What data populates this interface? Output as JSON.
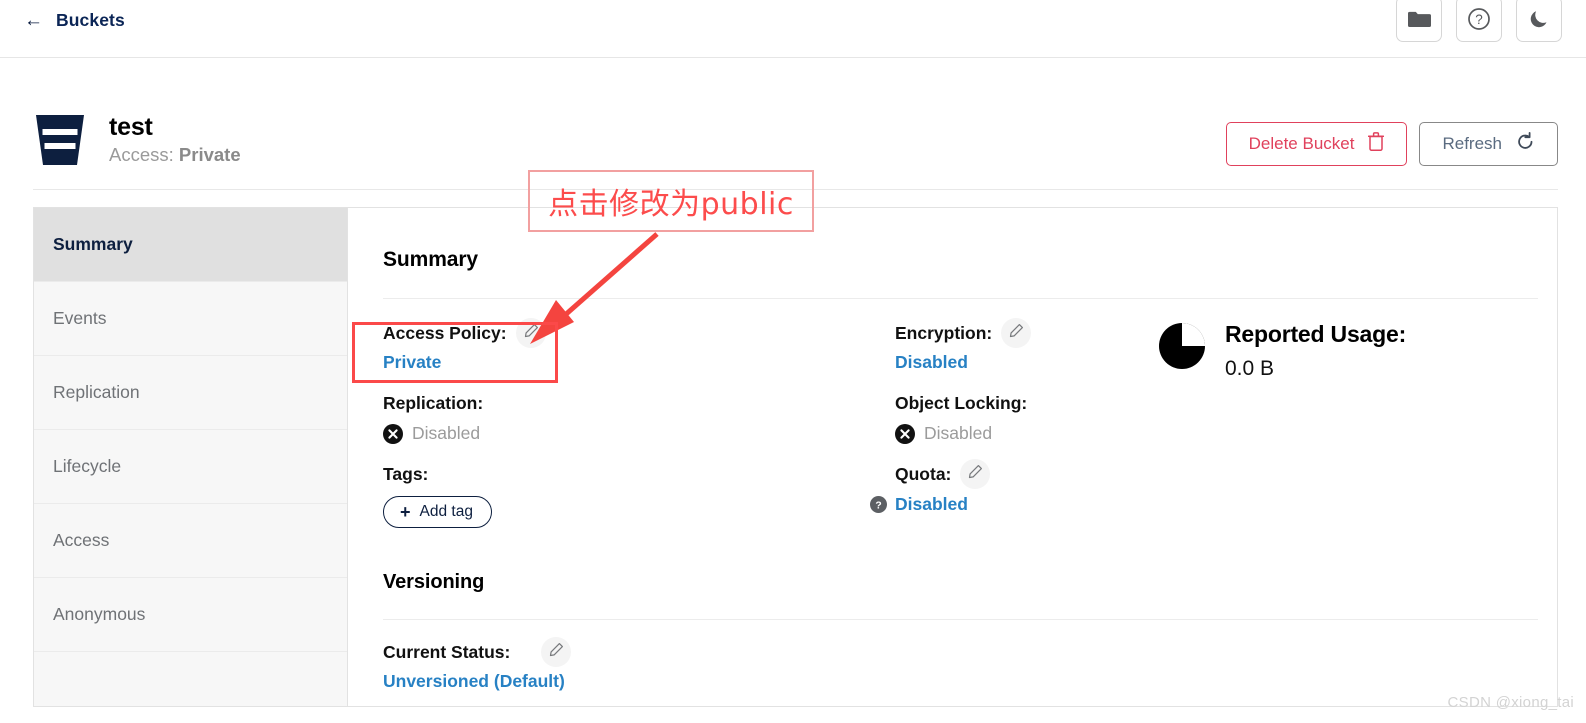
{
  "topbar": {
    "back_arrow": "←",
    "back_label": "Buckets",
    "actions": [
      {
        "name": "folder-icon",
        "label": "Folder"
      },
      {
        "name": "help-icon",
        "label": "Help"
      },
      {
        "name": "dark-mode-icon",
        "label": "Dark mode"
      }
    ]
  },
  "bucket": {
    "icon_name": "bucket-icon",
    "name": "test",
    "access_prefix": "Access:",
    "access_value": "Private",
    "delete_label": "Delete Bucket",
    "refresh_label": "Refresh"
  },
  "sidebar": {
    "items": [
      {
        "label": "Summary",
        "active": true
      },
      {
        "label": "Events",
        "active": false
      },
      {
        "label": "Replication",
        "active": false
      },
      {
        "label": "Lifecycle",
        "active": false
      },
      {
        "label": "Access",
        "active": false
      },
      {
        "label": "Anonymous",
        "active": false
      }
    ]
  },
  "summary": {
    "title": "Summary",
    "access_policy": {
      "label": "Access Policy:",
      "value": "Private"
    },
    "replication": {
      "label": "Replication:",
      "value": "Disabled"
    },
    "tags": {
      "label": "Tags:",
      "add_label": "Add tag",
      "plus": "+"
    },
    "encryption": {
      "label": "Encryption:",
      "value": "Disabled"
    },
    "object_locking": {
      "label": "Object Locking:",
      "value": "Disabled"
    },
    "quota": {
      "label": "Quota:",
      "value": "Disabled"
    },
    "reported_usage": {
      "label": "Reported Usage:",
      "value": "0.0 B"
    }
  },
  "versioning": {
    "title": "Versioning",
    "current_status": {
      "label": "Current Status:",
      "value": "Unversioned (Default)"
    }
  },
  "annotation": {
    "callout_text": "点击修改为public",
    "callout_color": "#fc4c4c",
    "box_border_color": "#fb4949"
  },
  "watermark": "CSDN @xiong_tai"
}
